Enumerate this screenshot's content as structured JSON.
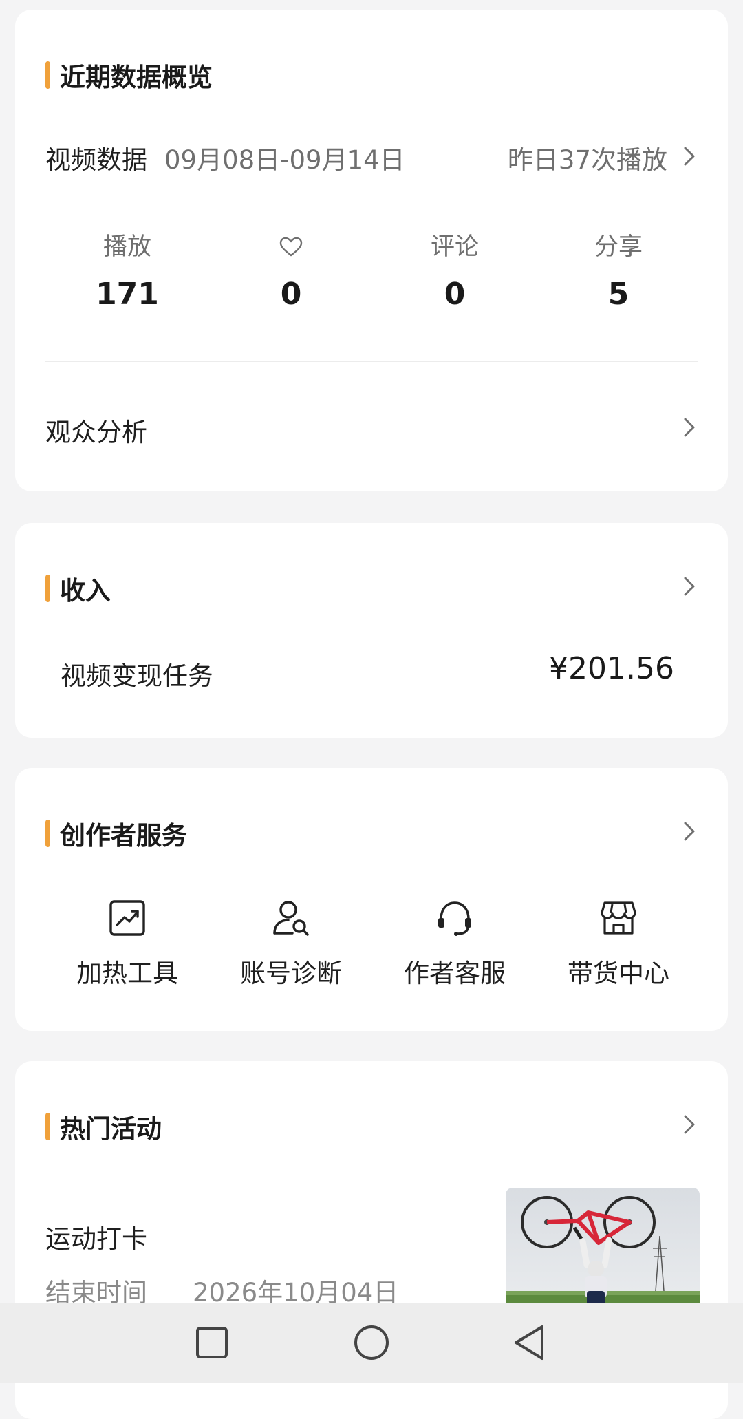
{
  "overview": {
    "title": "近期数据概览",
    "video_label": "视频数据",
    "date_range": "09月08日-09月14日",
    "yesterday": "昨日37次播放",
    "stats": [
      {
        "label": "播放",
        "value": "171",
        "icon": ""
      },
      {
        "label": "",
        "value": "0",
        "icon": "heart-icon"
      },
      {
        "label": "评论",
        "value": "0",
        "icon": ""
      },
      {
        "label": "分享",
        "value": "5",
        "icon": ""
      }
    ],
    "audience_label": "观众分析"
  },
  "income": {
    "title": "收入",
    "row_label": "视频变现任务",
    "row_value": "¥201.56"
  },
  "services": {
    "title": "创作者服务",
    "items": [
      {
        "label": "加热工具",
        "icon": "chart-trend-icon"
      },
      {
        "label": "账号诊断",
        "icon": "user-search-icon"
      },
      {
        "label": "作者客服",
        "icon": "headset-icon"
      },
      {
        "label": "带货中心",
        "icon": "store-icon"
      }
    ]
  },
  "activities": {
    "title": "热门活动",
    "item_name": "运动打卡",
    "end_label": "结束时间",
    "end_value": "2026年10月04日"
  },
  "nav": {
    "buttons": [
      "recent-apps-icon",
      "home-icon",
      "back-icon"
    ]
  },
  "colors": {
    "accent": "#f0a13b",
    "background": "#f4f4f5",
    "card": "#ffffff"
  }
}
